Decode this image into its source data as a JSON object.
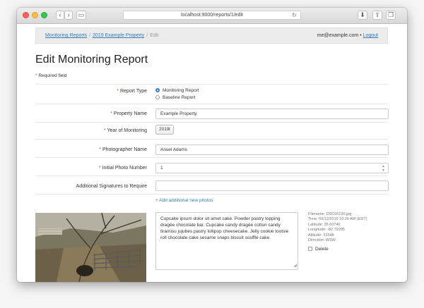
{
  "browser": {
    "url": "localhost:9000/reports/1/edit"
  },
  "breadcrumb": {
    "items": [
      "Monitoring Reports",
      "2019 Example Property"
    ],
    "current": "Edit"
  },
  "user": {
    "email": "me@example.com",
    "separator": "•",
    "logout": "Logout"
  },
  "page": {
    "title": "Edit Monitoring Report",
    "required_note": "Required field",
    "required_mark": "*"
  },
  "form": {
    "report_type_label": "Report Type",
    "report_type_options": [
      "Monitoring Report",
      "Baseline Report"
    ],
    "property_name_label": "Property Name",
    "property_name_value": "Example Property",
    "year_label": "Year of Monitoring",
    "year_value": "2019",
    "photographer_label": "Photographer Name",
    "photographer_value": "Ansel Adams",
    "initial_photo_label": "Initial Photo Number",
    "initial_photo_value": "1",
    "signatures_label": "Additional Signatures to Require",
    "signatures_value": ""
  },
  "photos": {
    "add_link": "+ Add additional new photos",
    "caption": "Cupcake ipsum dolor sit amet cake. Powder pastry topping dragée chocolate bar. Cupcake candy dragée cotton candy tiramisu jujubes pastry lollipop cheesecake. Jelly cookie tootsie roll chocolate cake sesame snaps biscuit soufflé cake.",
    "meta": [
      "Filename: DSC00120.jpg",
      "Time: 03/12/2019 10:26 AM (EDT)",
      "Latitude: 35.60746",
      "Longitude: -82.79205",
      "Altitude: 3164ft",
      "Direction: WSW"
    ],
    "delete_label": "Delete"
  },
  "colors": {
    "accent": "#337ab7",
    "required": "#e74c1c",
    "radio_selected": "#2e7de0"
  }
}
